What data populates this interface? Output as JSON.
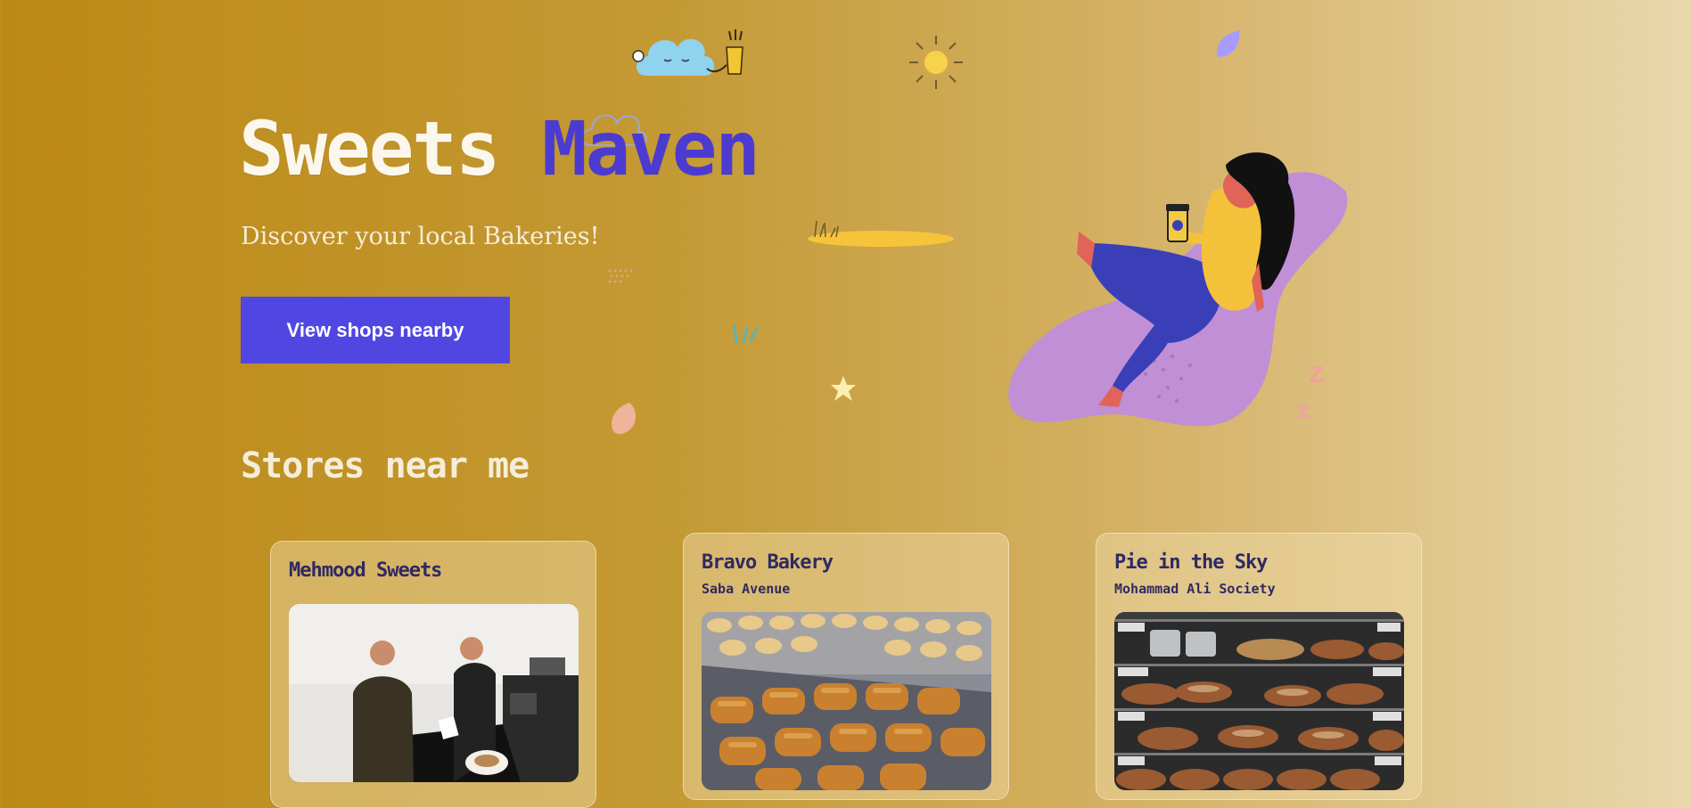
{
  "hero": {
    "title_part1": "Sweets",
    "title_part2": "Maven",
    "subtitle": "Discover your local Bakeries!",
    "cta_label": "View shops nearby"
  },
  "section": {
    "title": "Stores near me"
  },
  "stores": [
    {
      "name": "Mehmood Sweets",
      "area": "",
      "photo": "bakery-staff-serving-photo"
    },
    {
      "name": "Bravo Bakery",
      "area": "Saba Avenue",
      "photo": "pain-au-chocolat-tray-photo"
    },
    {
      "name": "Pie in the Sky",
      "area": "Mohammad Ali Society",
      "photo": "bread-shelves-photo"
    }
  ],
  "illustration": {
    "subject": "woman-sitting-with-coffee-illustration"
  },
  "colors": {
    "accent": "#5047e3",
    "title_accent": "#4c3bd1",
    "card_text": "#2f2a63",
    "background_start": "#bc8915",
    "background_end": "#e9d8ad"
  }
}
